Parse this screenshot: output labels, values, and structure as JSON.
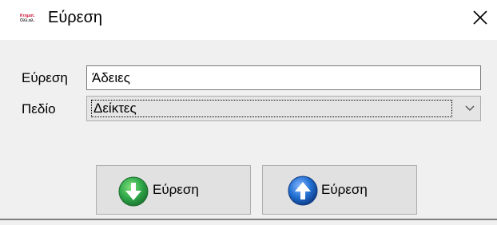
{
  "window": {
    "title": "Εύρεση",
    "icon": "app-logo-icon",
    "icon_lines": [
      "Κτηματ.",
      "Ολλ.αλ."
    ],
    "close_icon": "close-icon"
  },
  "form": {
    "find_label": "Εύρεση",
    "find_value": "Άδειες",
    "field_label": "Πεδίο",
    "field_value": "Δείκτες",
    "field_dropdown_icon": "chevron-down-icon"
  },
  "buttons": [
    {
      "label": "Εύρεση",
      "icon": "arrow-down-circle-icon",
      "color": "#2fa84a"
    },
    {
      "label": "Εύρεση",
      "icon": "arrow-up-circle-icon",
      "color": "#1f6fd1"
    }
  ]
}
